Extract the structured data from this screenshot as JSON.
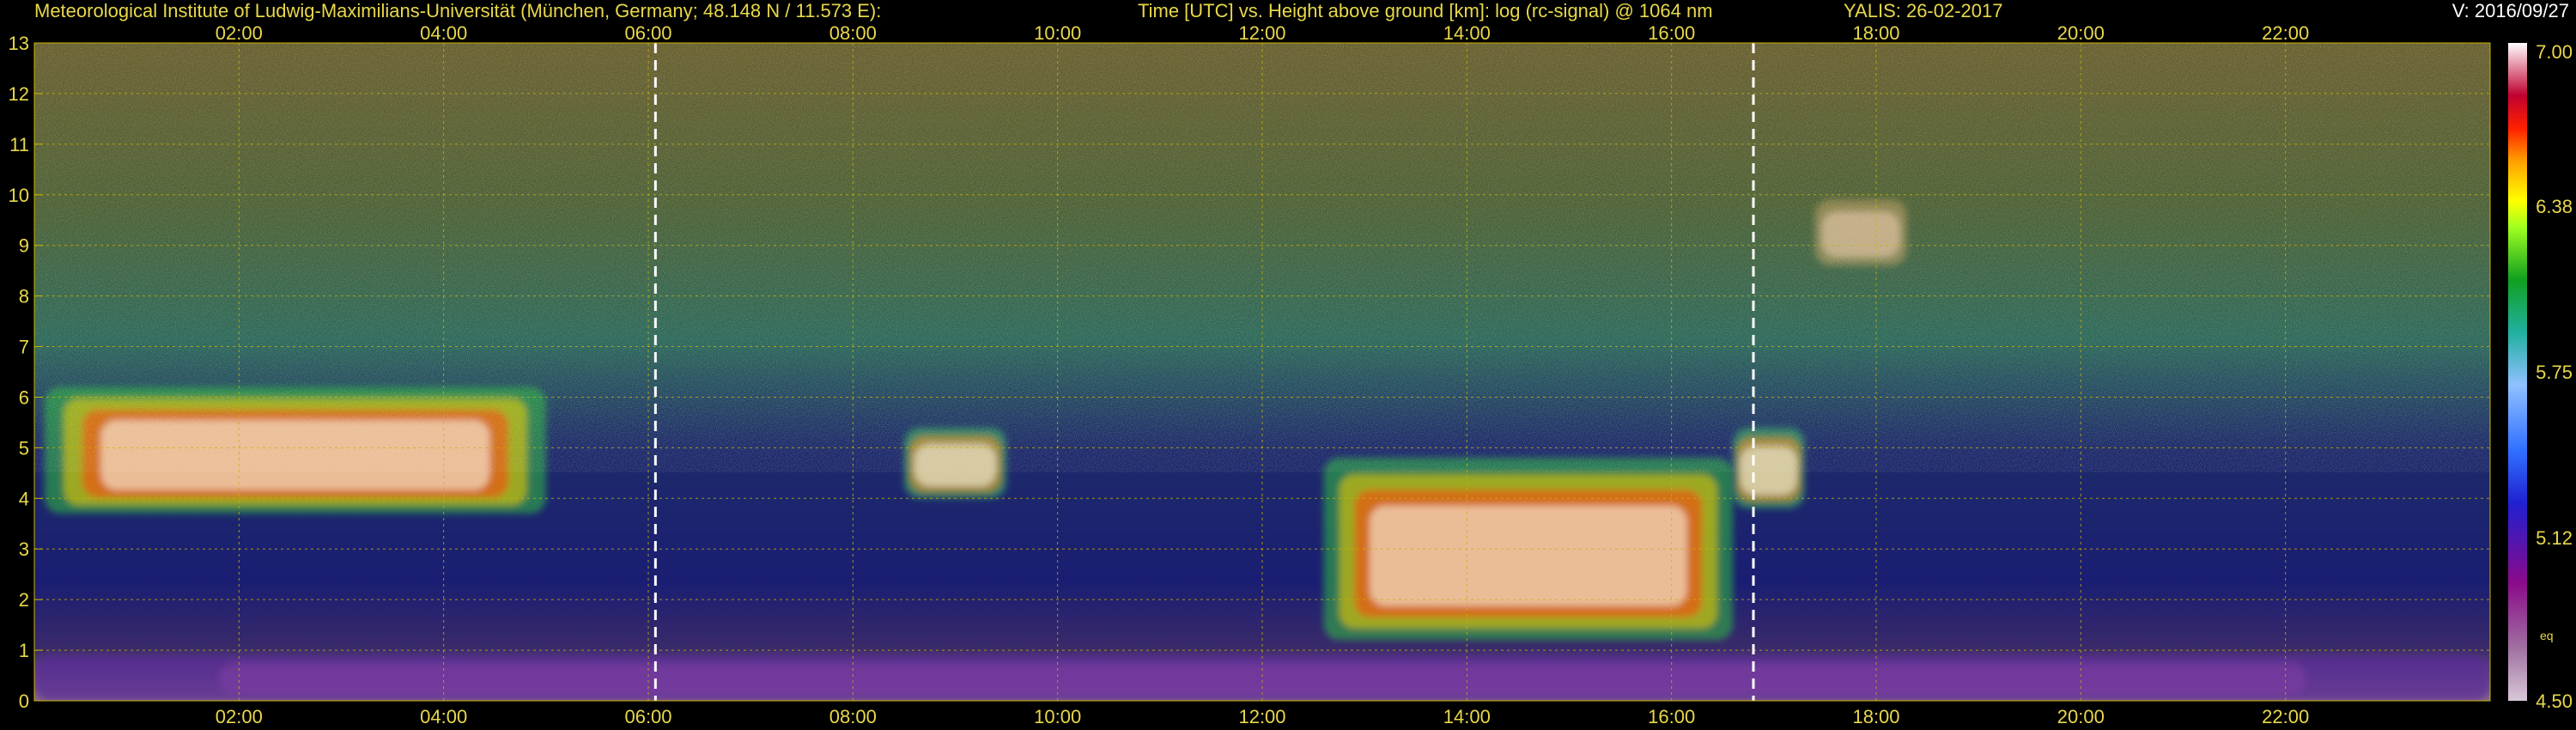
{
  "header": {
    "institute": "Meteorological Institute of Ludwig-Maximilians-Universität (München, Germany; 48.148 N / 11.573 E):",
    "axes_description": "Time [UTC] vs. Height above ground [km]: log (rc-signal) @ 1064 nm",
    "station_date": "YALIS: 26-02-2017",
    "version": "V: 2016/09/27"
  },
  "colors": {
    "background": "#000000",
    "text": "#e8d84a",
    "grid": "#c8b400",
    "marker_line": "#ffffff"
  },
  "chart_data": {
    "type": "heatmap",
    "x_ticks": [
      "02:00",
      "04:00",
      "06:00",
      "08:00",
      "10:00",
      "12:00",
      "14:00",
      "16:00",
      "18:00",
      "20:00",
      "22:00"
    ],
    "x_tick_hours": [
      2,
      4,
      6,
      8,
      10,
      12,
      14,
      16,
      18,
      20,
      22
    ],
    "xlim": [
      0,
      24
    ],
    "y_ticks": [
      "0",
      "1",
      "2",
      "3",
      "4",
      "5",
      "6",
      "7",
      "8",
      "9",
      "10",
      "11",
      "12",
      "13"
    ],
    "ylim": [
      0,
      13
    ],
    "colorbar": {
      "ticks": [
        "4.50",
        "5.12",
        "5.75",
        "6.38",
        "7.00"
      ],
      "values": [
        4.5,
        5.12,
        5.75,
        6.38,
        7.0
      ],
      "range": [
        4.5,
        7.0
      ],
      "label": "eq"
    },
    "vertical_markers_hours": [
      6.07,
      16.8
    ],
    "grid": true,
    "signal_features": [
      {
        "kind": "aerosol_layer",
        "t_start": 0.0,
        "t_end": 24.0,
        "h_bottom": 0.0,
        "h_top": 0.9
      },
      {
        "kind": "cloud_layer",
        "t_start": 0.1,
        "t_end": 5.0,
        "h_bottom": 3.7,
        "h_top": 6.2
      },
      {
        "kind": "cloud_patch",
        "t_start": 8.5,
        "t_end": 9.5,
        "h_bottom": 4.0,
        "h_top": 5.4
      },
      {
        "kind": "cloud_layer",
        "t_start": 12.6,
        "t_end": 16.6,
        "h_bottom": 1.2,
        "h_top": 4.8
      },
      {
        "kind": "cloud_patch",
        "t_start": 16.6,
        "t_end": 17.3,
        "h_bottom": 3.8,
        "h_top": 5.4
      },
      {
        "kind": "cirrus_patch",
        "t_start": 17.4,
        "t_end": 18.3,
        "h_bottom": 8.6,
        "h_top": 9.9
      }
    ]
  }
}
